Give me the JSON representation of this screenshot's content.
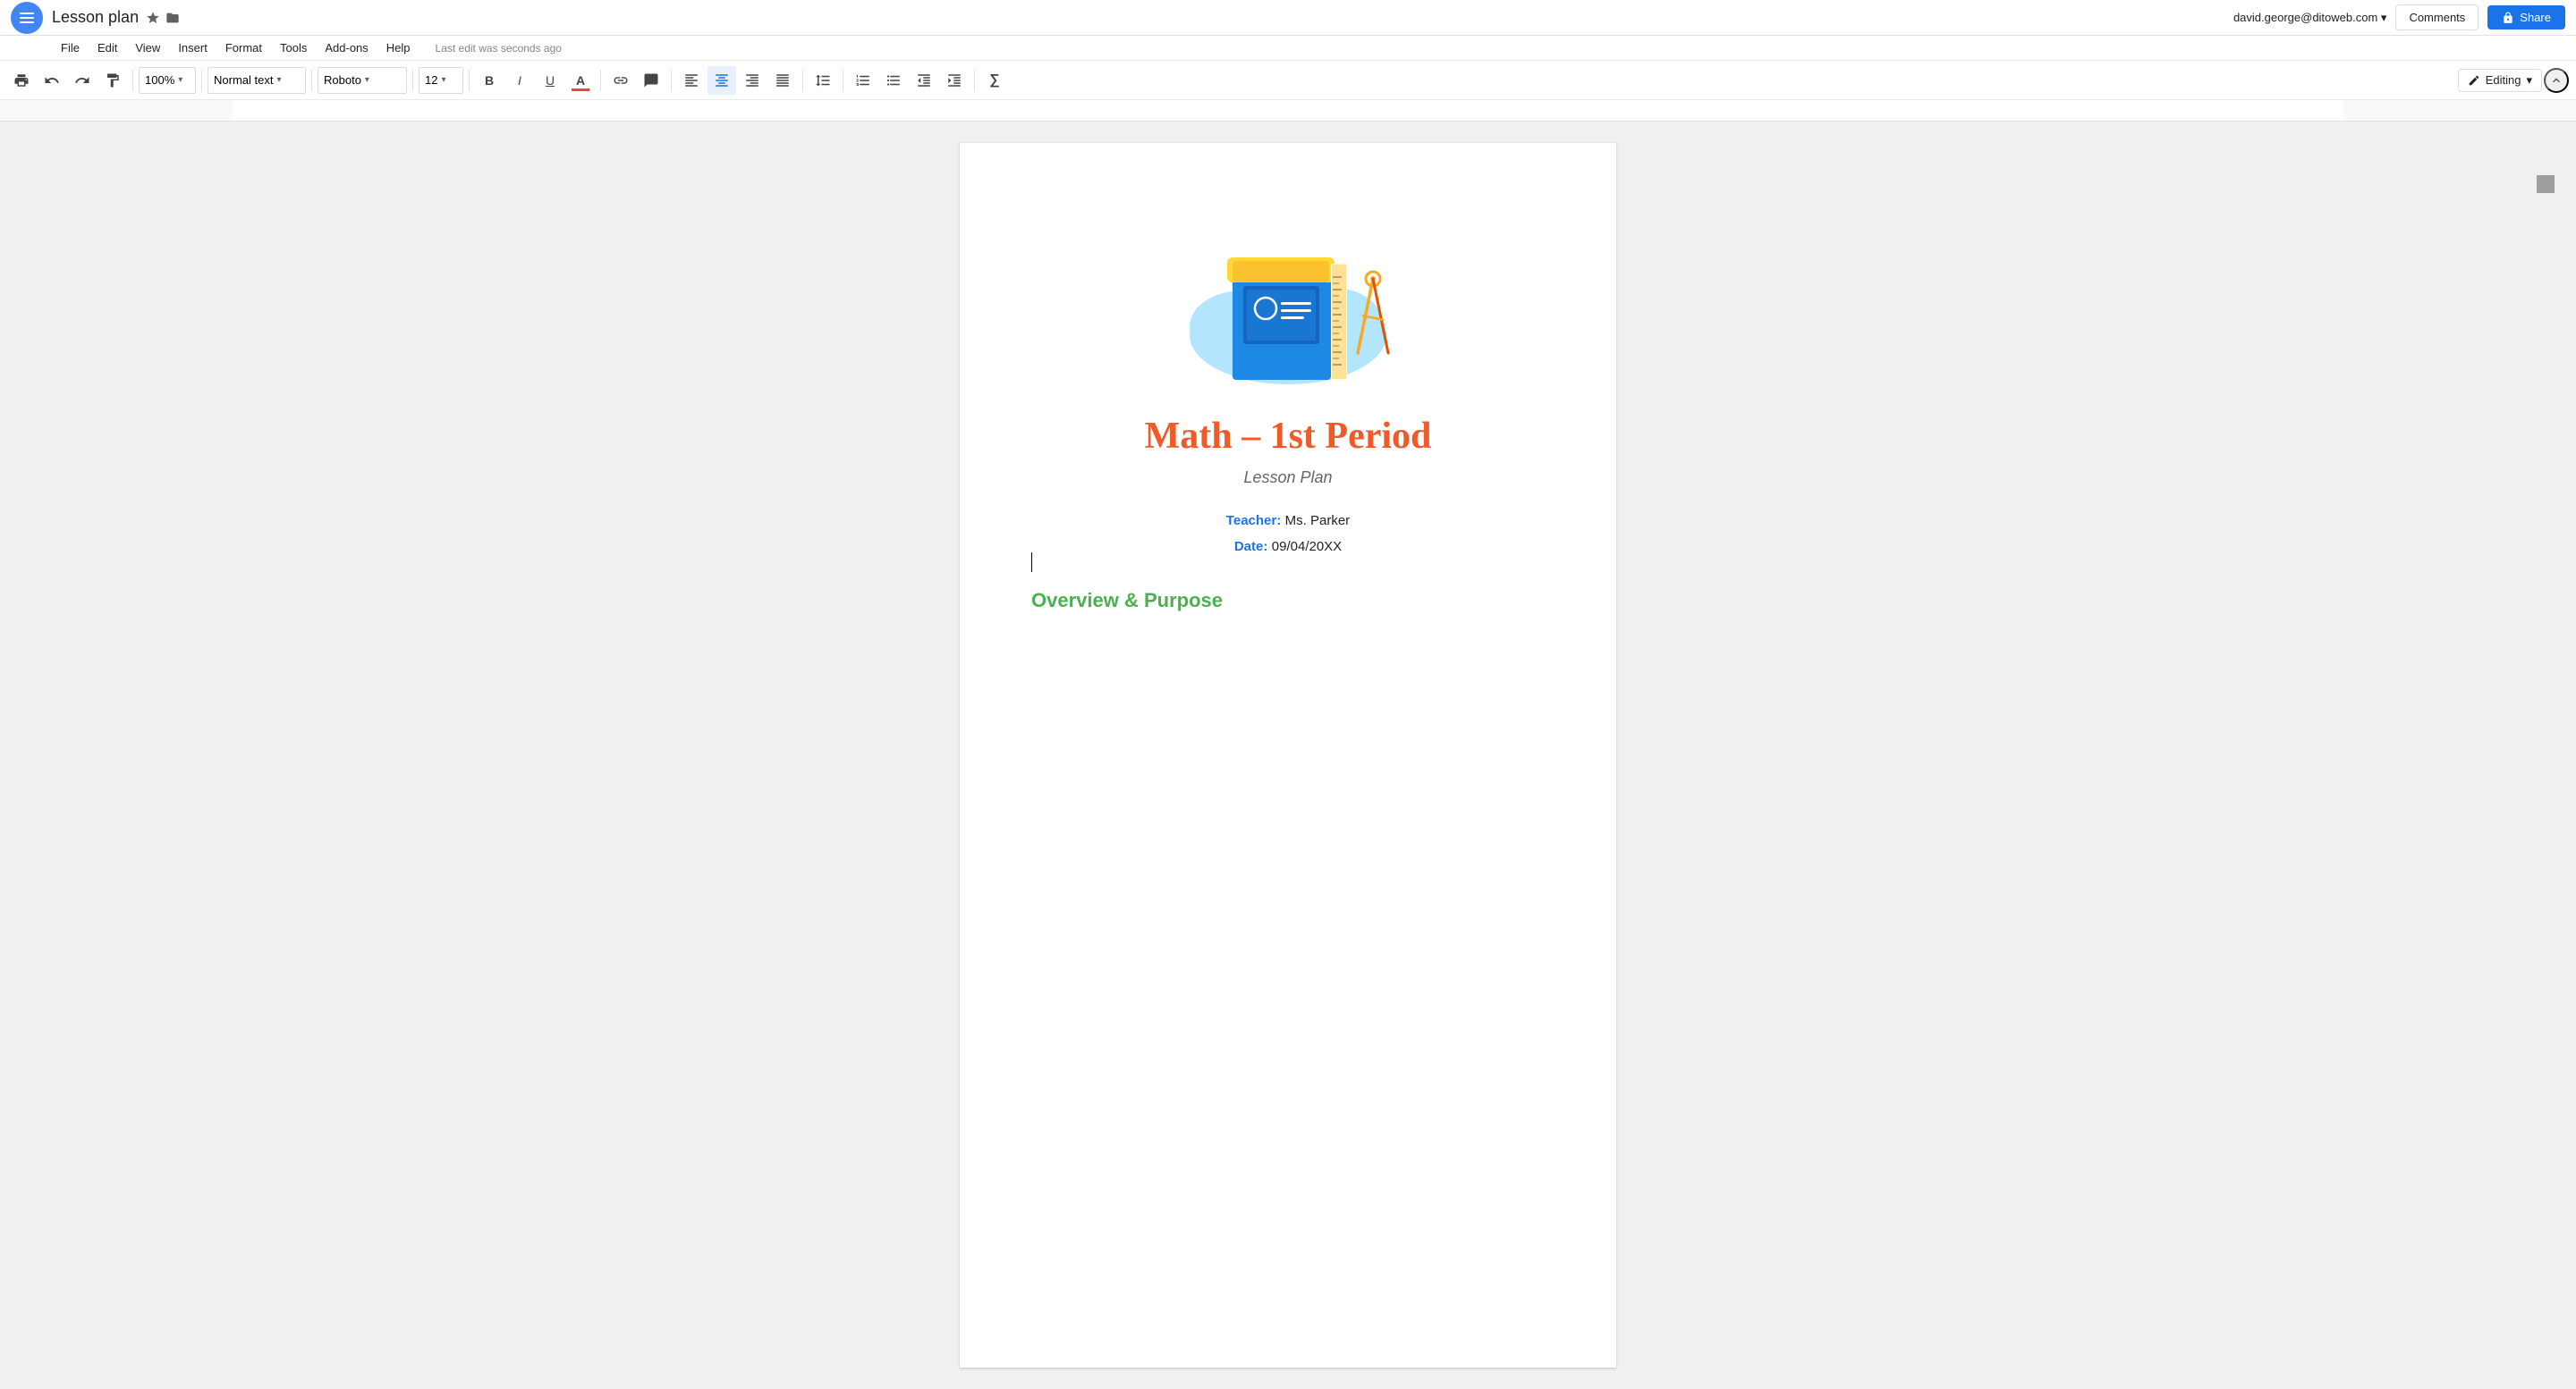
{
  "app": {
    "menu_icon": "≡",
    "title": "Lesson plan",
    "user_email": "david.george@ditoweb.com ▾"
  },
  "title_icons": {
    "star": "☆",
    "folder": "📁"
  },
  "top_buttons": {
    "comments": "Comments",
    "share": "Share"
  },
  "menu": {
    "items": [
      "File",
      "Edit",
      "View",
      "Insert",
      "Format",
      "Tools",
      "Add-ons",
      "Help"
    ],
    "last_edit": "Last edit was seconds ago"
  },
  "toolbar": {
    "print": "🖨",
    "undo": "↩",
    "redo": "↪",
    "paint_format": "🖌",
    "zoom": "100%",
    "style": "Normal text",
    "font": "Roboto",
    "size": "12",
    "bold": "B",
    "italic": "I",
    "underline": "U",
    "font_color": "A",
    "link": "🔗",
    "comment": "💬",
    "align_left": "≡",
    "align_center": "≡",
    "align_right": "≡",
    "justify": "≡",
    "line_spacing": "↕",
    "numbered_list": "1.",
    "bulleted_list": "•",
    "indent_less": "⇤",
    "indent_more": "⇥",
    "formula": "∑",
    "editing_mode": "Editing",
    "collapse": "^"
  },
  "document": {
    "illustration_alt": "Math school supplies illustration",
    "title": "Math – 1st Period",
    "subtitle": "Lesson Plan",
    "teacher_label": "Teacher:",
    "teacher_value": "Ms. Parker",
    "date_label": "Date:",
    "date_value": "09/04/20XX",
    "section_title": "Overview & Purpose"
  }
}
